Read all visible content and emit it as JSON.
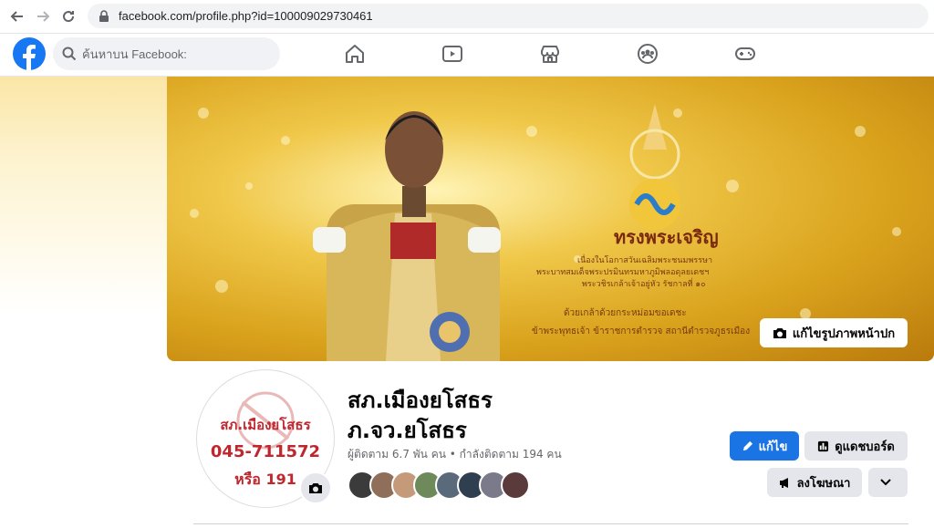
{
  "browser": {
    "url": "facebook.com/profile.php?id=100009029730461"
  },
  "search": {
    "placeholder": "ค้นหาบน Facebook:"
  },
  "nav": [
    "home-icon",
    "watch-icon",
    "marketplace-icon",
    "groups-icon",
    "gaming-icon"
  ],
  "cover": {
    "edit_label": "แก้ไขรูปภาพหน้าปก",
    "title": "ทรงพระเจริญ",
    "line1": "เนื่องในโอกาสวันเฉลิมพระชนมพรรษา",
    "line2": "พระบาทสมเด็จพระปรมินทรมหาภูมิพลอดุลยเดชฯ",
    "line3": "พระวชิรเกล้าเจ้าอยู่หัว รัชกาลที่ ๑๐",
    "line4": "ด้วยเกล้าด้วยกระหม่อมขอเดชะ",
    "line5": "ข้าพระพุทธเจ้า ข้าราชการตำรวจ สถานีตำรวจภูธรเมือง"
  },
  "profile": {
    "avatar_lines": [
      "สภ.เมืองยโสธร",
      "045-711572",
      "หรือ 191"
    ],
    "name_line1": "สภ.เมืองยโสธร",
    "name_line2": "ภ.จว.ยโสธร",
    "stats": "ผู้ติดตาม 6.7 พัน คน • กำลังติดตาม 194 คน"
  },
  "actions": {
    "edit": "แก้ไข",
    "dashboard": "ดูแดชบอร์ด",
    "advertise": "ลงโฆษณา"
  },
  "colors": {
    "primary": "#1b74e4",
    "fb_blue": "#1877f2",
    "avatar_red": "#c0262d"
  }
}
